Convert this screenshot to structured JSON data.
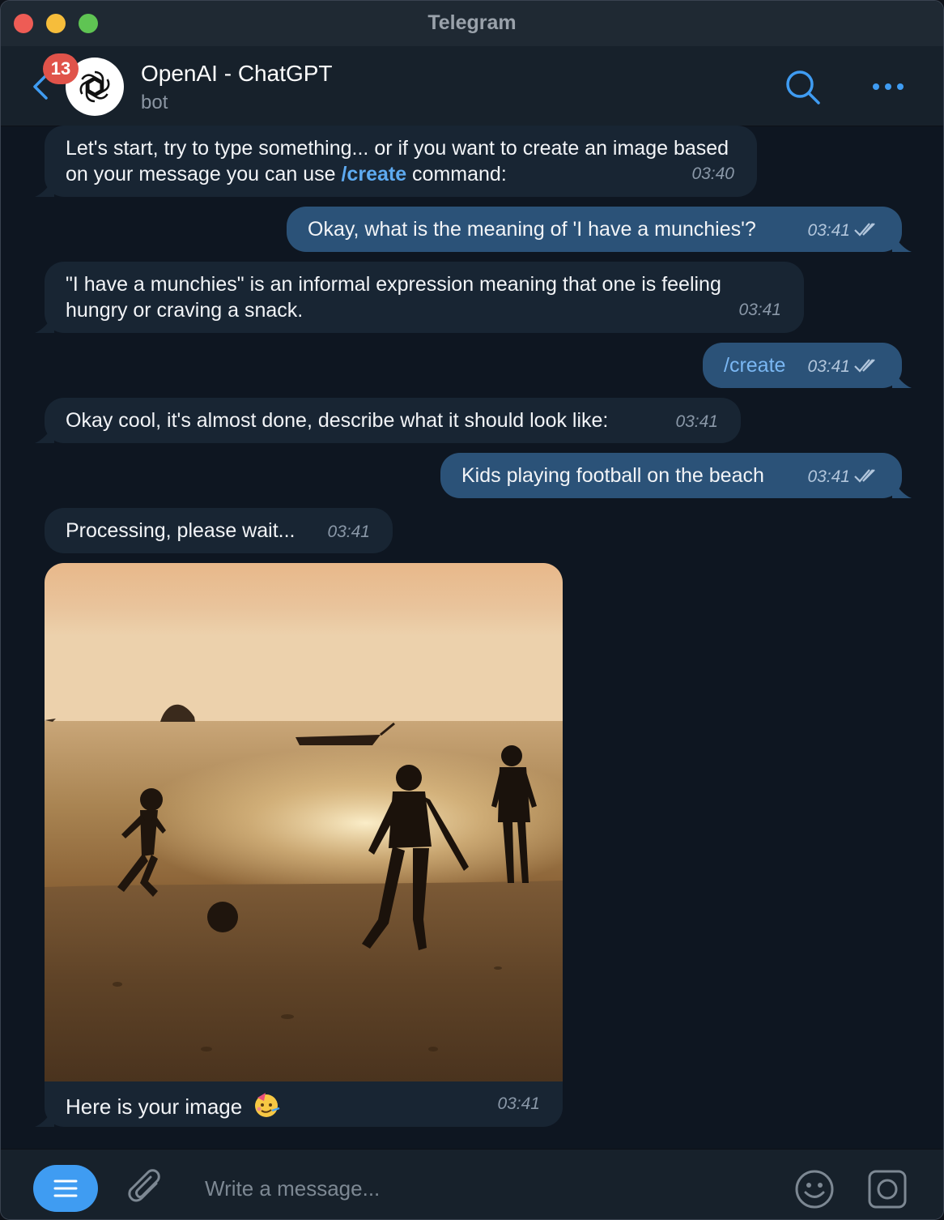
{
  "window": {
    "title": "Telegram"
  },
  "header": {
    "unread_count": "13",
    "chat_name": "OpenAI - ChatGPT",
    "chat_status": "bot",
    "avatar_icon": "openai-logo-icon",
    "search_icon": "search-icon",
    "more_icon": "more-horizontal-icon"
  },
  "messages": [
    {
      "direction": "in",
      "text_part1": "Let's start, try to type something... or if you want to create an image based on your message you can use ",
      "command": "/create",
      "text_part2": " command:",
      "time": "03:40"
    },
    {
      "direction": "out",
      "text": "Okay, what is the meaning of 'I have a munchies'?",
      "time": "03:41",
      "status": "read"
    },
    {
      "direction": "in",
      "text": "\"I have a munchies\" is an informal expression meaning that one is feeling hungry or craving a snack.",
      "time": "03:41"
    },
    {
      "direction": "out",
      "text": "/create",
      "time": "03:41",
      "status": "read"
    },
    {
      "direction": "in",
      "text": "Okay cool, it's almost done, describe what it should look like:",
      "time": "03:41"
    },
    {
      "direction": "out",
      "text": "Kids playing football on the beach",
      "time": "03:41",
      "status": "read"
    },
    {
      "direction": "in",
      "text": "Processing, please wait...",
      "time": "03:41"
    },
    {
      "direction": "in",
      "type": "photo",
      "caption": "Here is your image",
      "caption_emoji": "partying-face-emoji",
      "time": "03:41"
    }
  ],
  "composer": {
    "placeholder": "Write a message...",
    "menu_icon": "bot-menu-icon",
    "attach_icon": "paperclip-icon",
    "emoji_icon": "smile-icon",
    "camera_icon": "instant-video-icon"
  },
  "colors": {
    "accent": "#3f9cf2",
    "incoming_bubble": "#182533",
    "outgoing_bubble": "#2b5278",
    "badge": "#e0534a"
  }
}
